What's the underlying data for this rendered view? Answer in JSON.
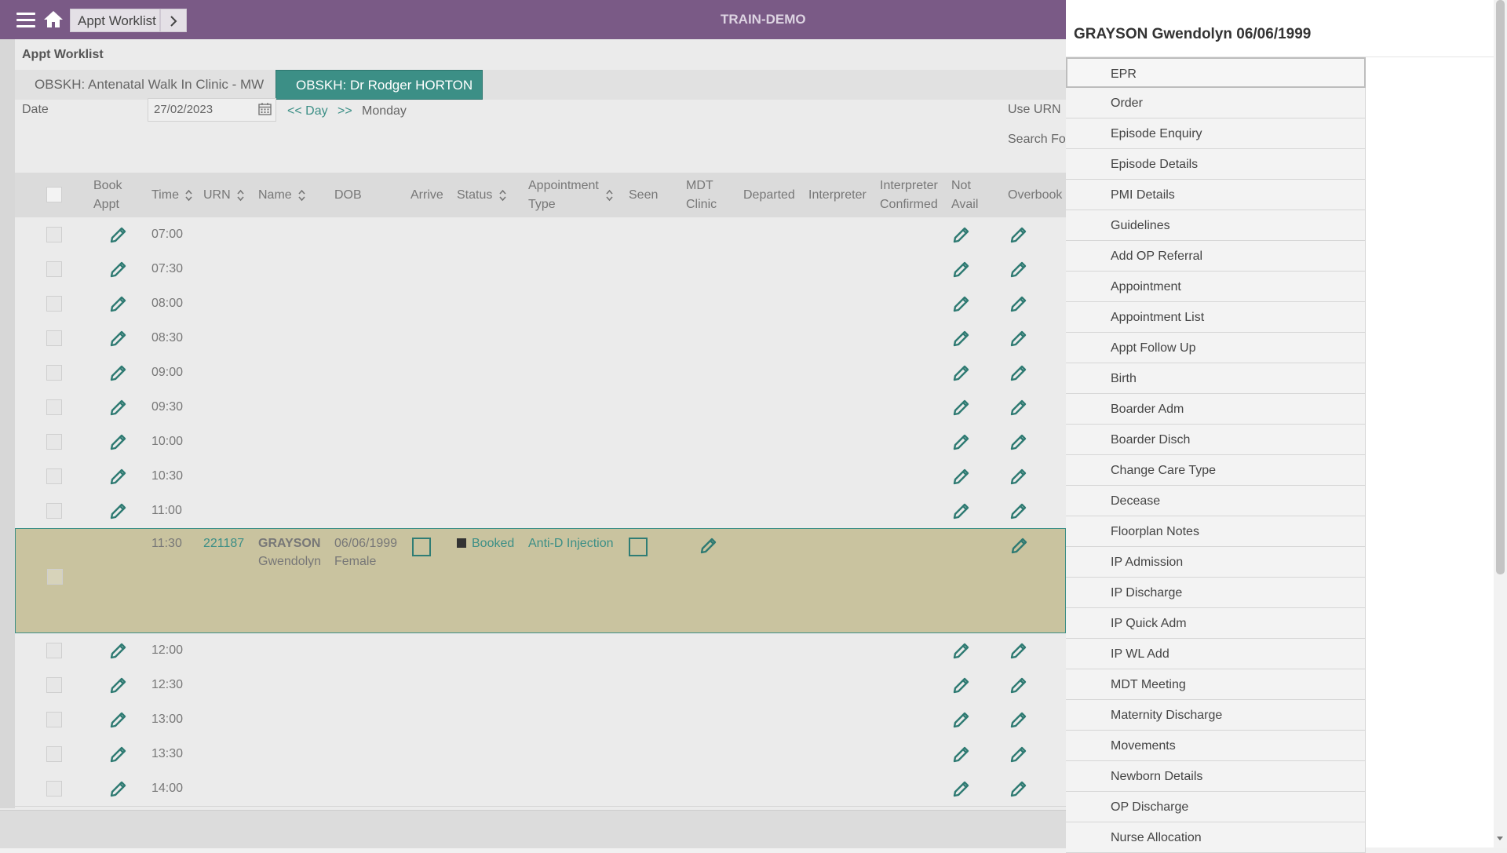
{
  "app": {
    "breadcrumb": "Appt Worklist",
    "environment": "TRAIN-DEMO"
  },
  "page": {
    "title": "Appt Worklist",
    "tabs": [
      "OBSKH: Antenatal Walk In Clinic - MW",
      "OBSKH: Dr Rodger HORTON"
    ],
    "date_label": "Date",
    "date_value": "27/02/2023",
    "prev_day": "<< Day",
    "next_day": ">>",
    "weekday": "Monday",
    "use_urn": "Use URN",
    "search_for": "Search Fo"
  },
  "table": {
    "headers": {
      "book_appt_1": "Book",
      "book_appt_2": "Appt",
      "time": "Time",
      "urn": "URN",
      "name": "Name",
      "dob": "DOB",
      "arrive": "Arrive",
      "status": "Status",
      "appt_type_1": "Appointment",
      "appt_type_2": "Type",
      "seen": "Seen",
      "mdt_1": "MDT",
      "mdt_2": "Clinic",
      "departed": "Departed",
      "interpreter": "Interpreter",
      "interp_conf_1": "Interpreter",
      "interp_conf_2": "Confirmed",
      "not_avail_1": "Not",
      "not_avail_2": "Avail",
      "overbook": "Overbook"
    },
    "slots_before": [
      "07:00",
      "07:30",
      "08:00",
      "08:30",
      "09:00",
      "09:30",
      "10:00",
      "10:30",
      "11:00"
    ],
    "booked": {
      "time": "11:30",
      "urn": "221187",
      "surname": "GRAYSON",
      "given": "Gwendolyn",
      "dob": "06/06/1999",
      "sex": "Female",
      "status": "Booked",
      "appt_type": "Anti-D Injection"
    },
    "slots_after": [
      "12:00",
      "12:30",
      "13:00",
      "13:30",
      "14:00"
    ]
  },
  "context_menu": {
    "title": "GRAYSON Gwendolyn 06/06/1999",
    "items": [
      "EPR",
      "Order",
      "Episode Enquiry",
      "Episode Details",
      "PMI Details",
      "Guidelines",
      "Add OP Referral",
      "Appointment",
      "Appointment List",
      "Appt Follow Up",
      "Birth",
      "Boarder Adm",
      "Boarder Disch",
      "Change Care Type",
      "Decease",
      "Floorplan Notes",
      "IP Admission",
      "IP Discharge",
      "IP Quick Adm",
      "IP WL Add",
      "MDT Meeting",
      "Maternity Discharge",
      "Movements",
      "Newborn Details",
      "OP Discharge",
      "Nurse Allocation"
    ]
  },
  "colors": {
    "header_purple": "#7a5a86",
    "accent_teal": "#3c8f86",
    "booked_row": "#c9c39f"
  }
}
